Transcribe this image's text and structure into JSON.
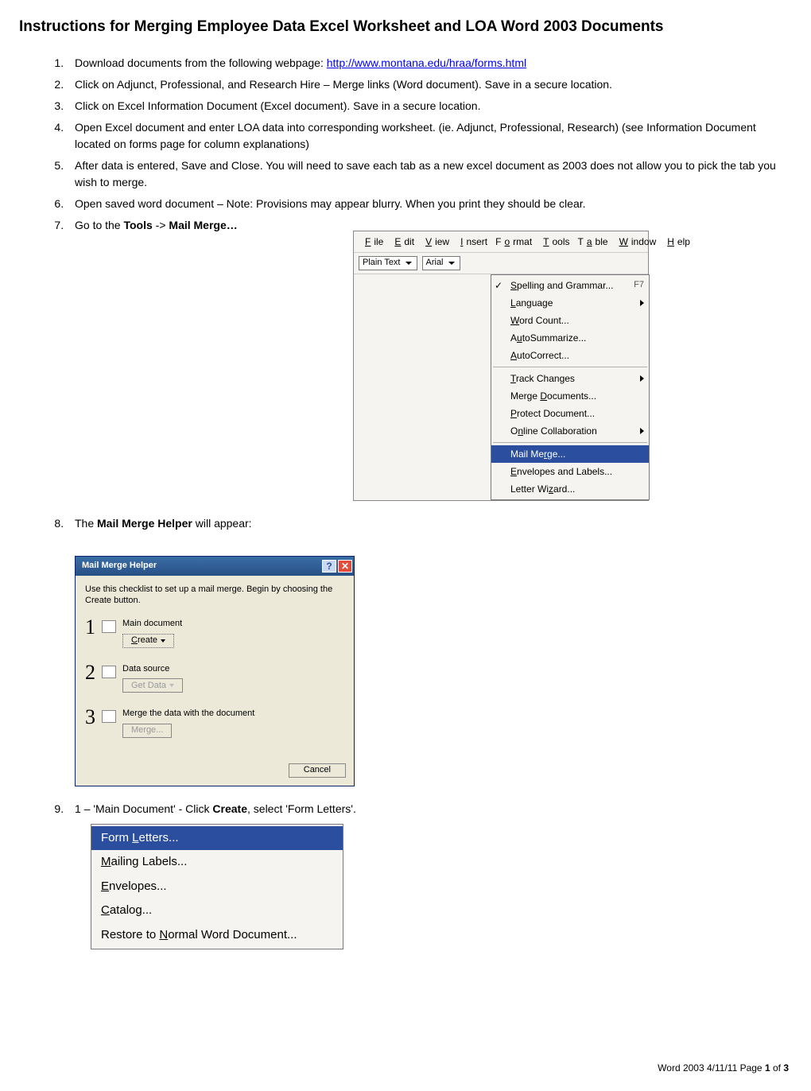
{
  "title": "Instructions for Merging Employee Data Excel Worksheet and LOA Word 2003 Documents",
  "steps": {
    "s1a": "Download documents from the following webpage: ",
    "s1link": "http://www.montana.edu/hraa/forms.html",
    "s2": "Click on Adjunct, Professional, and Research Hire – Merge links (Word document).  Save in a secure location.",
    "s3": "Click on Excel Information Document (Excel document). Save in a secure location.",
    "s4": "Open Excel document and enter LOA data into corresponding worksheet. (ie. Adjunct, Professional, Research) (see Information Document located on forms page for column explanations)",
    "s5": "After data is entered, Save and Close.  You will need to save each tab as a new excel document as 2003 does not allow you to pick the tab you wish to merge.",
    "s6": "Open saved word document – Note: Provisions may appear blurry. When you print they should be clear.",
    "s7a": "Go to the ",
    "s7b": "Tools",
    "s7c": " -> ",
    "s7d": "Mail Merge…",
    "s8a": "The ",
    "s8b": "Mail Merge Helper",
    "s8c": " will appear:",
    "s9a": "1 – 'Main Document' - Click ",
    "s9b": "Create",
    "s9c": ", select 'Form Letters'."
  },
  "menu": {
    "bar": [
      "File",
      "Edit",
      "View",
      "Insert",
      "Format",
      "Tools",
      "Table",
      "Window",
      "Help"
    ],
    "combo1": "Plain Text",
    "combo2": "Arial",
    "items": [
      {
        "t": "Spelling and Grammar...",
        "kbd": "F7",
        "icon": true
      },
      {
        "t": "Language",
        "sub": true
      },
      {
        "t": "Word Count..."
      },
      {
        "t": "AutoSummarize...",
        "icon": true
      },
      {
        "t": "AutoCorrect..."
      }
    ],
    "items2": [
      {
        "t": "Track Changes",
        "sub": true
      },
      {
        "t": "Merge Documents..."
      },
      {
        "t": "Protect Document..."
      },
      {
        "t": "Online Collaboration",
        "sub": true
      }
    ],
    "items3": [
      {
        "t": "Mail Merge...",
        "sel": true
      },
      {
        "t": "Envelopes and Labels...",
        "icon": true
      },
      {
        "t": "Letter Wizard..."
      }
    ]
  },
  "mmh": {
    "title": "Mail Merge Helper",
    "hint": "Use this checklist to set up a mail merge. Begin by choosing the Create button.",
    "step1": "Main document",
    "btn1": "Create",
    "step2": "Data source",
    "btn2": "Get Data",
    "step3": "Merge the data with the document",
    "btn3": "Merge...",
    "cancel": "Cancel"
  },
  "create_menu": {
    "i1": "Form Letters...",
    "u1": "L",
    "i2": "Mailing Labels...",
    "u2": "M",
    "i3": "Envelopes...",
    "u3": "E",
    "i4": "Catalog...",
    "u4": "C",
    "i5": "Restore to Normal Word Document...",
    "u5": "N"
  },
  "footer": {
    "a": "Word 2003  4/11/11 Page ",
    "b": "1",
    "c": " of ",
    "d": "3"
  }
}
